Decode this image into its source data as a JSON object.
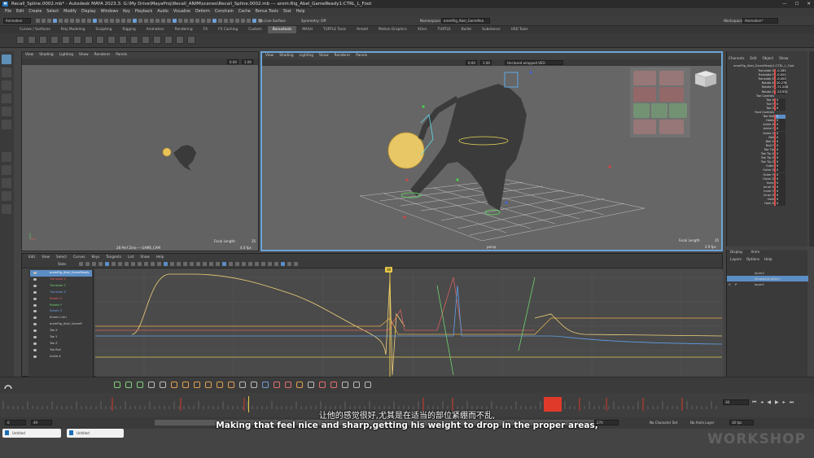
{
  "titlebar": {
    "text": "Recall_Spline.0002.mb* - Autodesk MAYA 2023.3: G:\\My Drive\\MayaProj\\Recall_ANIM\\scenes\\Recall_Spline.0002.mb  ---  arom:Rig_Abel_GameReady1:CTRL_L_Foot",
    "app_icon": "M"
  },
  "menubar": [
    "File",
    "Edit",
    "Create",
    "Select",
    "Modify",
    "Display",
    "Windows",
    "Key",
    "Playback",
    "Audio",
    "Visualize",
    "Deform",
    "Constrain",
    "Cache",
    "Bonus Tools",
    "Stat",
    "Help"
  ],
  "statusline": {
    "mode": "Animation",
    "live_surface": "No Live Surface",
    "symmetry": "Symmetry: Off",
    "namespace_label": "Namespace:",
    "namespace_value": "aromRig_Abel_GameRea",
    "workspace_label": "Workspace:",
    "workspace_value": "Animation*"
  },
  "shelf_tabs": [
    "Curves / Surfaces",
    "Poly Modeling",
    "Sculpting",
    "Rigging",
    "Animation",
    "Rendering",
    "FX",
    "FX Caching",
    "Custom",
    "Bonustools",
    "MASH",
    "TURTLE Tools",
    "Arnold",
    "Motion Graphics",
    "XGen",
    "TURTLE",
    "Bullet",
    "Substance",
    "USD Tools"
  ],
  "shelf_active_tab": "Bonustools",
  "viewport_menu": [
    "View",
    "Shading",
    "Lighting",
    "Show",
    "Renderer",
    "Panels"
  ],
  "viewport_left": {
    "label_bottom": "28 Perf Zero — GAME_CAM",
    "focal_label": "Focal Length:",
    "focal_value": "35",
    "fps": "4.0 fps",
    "field_a": "0.00",
    "field_b": "1.00"
  },
  "viewport_right": {
    "camera_dropdown": "Unclosed wrapped VEO",
    "label_bottom": "persp",
    "focal_label": "Focal Length:",
    "focal_value": "35",
    "fps": "2.9 fps",
    "field_a": "0.00",
    "field_b": "1.00"
  },
  "channelbox": {
    "tabs": [
      "Channels",
      "Edit",
      "Object",
      "Show"
    ],
    "object_name": "aromRig_Abel_GameReady1:CTRL_L_Foot",
    "channels": [
      {
        "name": "Translate X",
        "value": "-0.285"
      },
      {
        "name": "Translate Y",
        "value": "-0.022"
      },
      {
        "name": "Translate Z",
        "value": "-0.053"
      },
      {
        "name": "Rotate X",
        "value": "20.278"
      },
      {
        "name": "Rotate Y",
        "value": "-71.228"
      },
      {
        "name": "Rotate Z",
        "value": "-15.931"
      },
      {
        "name": "Toe Controls",
        "value": ""
      },
      {
        "name": "Toe X",
        "value": "0"
      },
      {
        "name": "Toe Y",
        "value": "0"
      },
      {
        "name": "Toe Z",
        "value": "0"
      },
      {
        "name": "Foot Controls",
        "value": ""
      },
      {
        "name": "Toe Roll",
        "value": "0"
      },
      {
        "name": "Heels",
        "value": "0"
      },
      {
        "name": "Ankle X",
        "value": "0"
      },
      {
        "name": "Ankle Y",
        "value": "0"
      },
      {
        "name": "Ankle Z",
        "value": "0"
      },
      {
        "name": "Ball",
        "value": "0"
      },
      {
        "name": "Ball X",
        "value": "0"
      },
      {
        "name": "Ball Y",
        "value": "0"
      },
      {
        "name": "Toe Tip",
        "value": "0"
      },
      {
        "name": "Toe Tip X",
        "value": "0"
      },
      {
        "name": "Toe Tip Z",
        "value": "0"
      },
      {
        "name": "Toe Tip Z",
        "value": "0"
      },
      {
        "name": "Outer",
        "value": "0"
      },
      {
        "name": "Outer X",
        "value": "0"
      },
      {
        "name": "Outer Y",
        "value": "0"
      },
      {
        "name": "Outer Z",
        "value": "0"
      },
      {
        "name": "Inner",
        "value": "0"
      },
      {
        "name": "Inner X",
        "value": "0"
      },
      {
        "name": "Inner Y",
        "value": "0"
      },
      {
        "name": "Inner Z",
        "value": "0"
      },
      {
        "name": "Heel",
        "value": "0"
      },
      {
        "name": "Heel X",
        "value": "0"
      }
    ]
  },
  "layerpanel": {
    "tabs": [
      "Display",
      "Anim"
    ],
    "menu": [
      "Layers",
      "Options",
      "Help"
    ],
    "layers": [
      {
        "name": "layer2",
        "vis": "",
        "ref": ""
      },
      {
        "name": "showperentitech",
        "vis": "",
        "ref": ""
      },
      {
        "name": "layer1",
        "vis": "V",
        "ref": "P"
      }
    ]
  },
  "graph_editor": {
    "menu": [
      "Edit",
      "View",
      "Select",
      "Curves",
      "Keys",
      "Tangents",
      "List",
      "Show",
      "Help"
    ],
    "stats_label": "Stats",
    "outliner": [
      {
        "label": "aromRig_Abel_GameReady",
        "color": "#ffffff",
        "selected": true
      },
      {
        "label": "Translate X",
        "color": "#e05a5a"
      },
      {
        "label": "Translate Y",
        "color": "#6fd36f"
      },
      {
        "label": "Translate Z",
        "color": "#6f9fe0"
      },
      {
        "label": "Rotate X",
        "color": "#e05a5a"
      },
      {
        "label": "Rotate Y",
        "color": "#6fd36f"
      },
      {
        "label": "Rotate Z",
        "color": "#6f9fe0"
      },
      {
        "label": "Knees Cntrl",
        "color": "#cccccc"
      },
      {
        "label": "aromRig_Abel_GameR",
        "color": "#cccccc"
      },
      {
        "label": "Toe X",
        "color": "#cccccc"
      },
      {
        "label": "Toe Y",
        "color": "#cccccc"
      },
      {
        "label": "Toe Z",
        "color": "#cccccc"
      },
      {
        "label": "Toe Roll",
        "color": "#cccccc"
      },
      {
        "label": "Ankle X",
        "color": "#cccccc"
      }
    ],
    "current_frame_marker": "30"
  },
  "timeslider": {
    "current_frame": "30",
    "range_start": "0",
    "range_start_inner": "49",
    "range_end_inner": "270",
    "range_end": "270",
    "char_set": "No Character Set",
    "anim_layer": "No Anim Layer",
    "fps": "30 fps"
  },
  "subtitles": {
    "cn": "让他的感觉很好,尤其是在适当的部位紧绷而不乱,",
    "en": "Making that feel nice and sharp,getting his weight to drop in the proper areas,"
  },
  "watermark": "WORKSHOP",
  "taskbar": {
    "item1": "Untitled",
    "item2": "Untitled"
  }
}
